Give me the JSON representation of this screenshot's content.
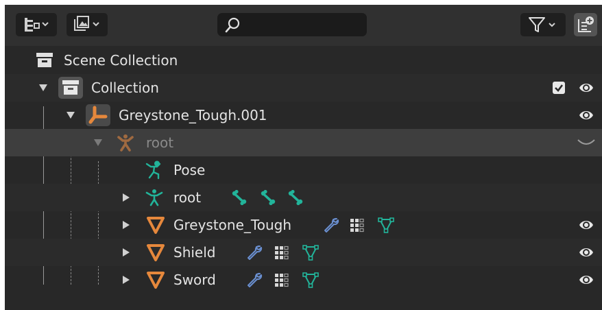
{
  "header": {
    "display_mode_icon": "outliner-view-icon",
    "filter_menu_icon": "image-stack-icon",
    "search": {
      "value": "",
      "placeholder": ""
    },
    "filter_icon": "funnel-icon",
    "new_collection_icon": "new-collection-icon"
  },
  "tree": {
    "scene_collection": {
      "label": "Scene Collection",
      "icon": "scene-collection-icon"
    },
    "collection": {
      "label": "Collection",
      "icon": "collection-icon",
      "checked": true,
      "visible": true
    },
    "armature_object": {
      "label": "Greystone_Tough.001",
      "icon": "armature-object-icon",
      "visible": true
    },
    "root_armature": {
      "label": "root",
      "icon": "armature-data-icon"
    },
    "pose": {
      "label": "Pose",
      "icon": "pose-icon"
    },
    "root_bone": {
      "label": "root",
      "icon": "bone-root-icon",
      "bones": [
        "bone-icon",
        "bone-icon",
        "bone-icon"
      ]
    },
    "meshes": [
      {
        "label": "Greystone_Tough",
        "icon": "mesh-object-icon",
        "modifiers": [
          "wrench-icon",
          "vertex-groups-icon",
          "mesh-data-icon"
        ],
        "visible": true
      },
      {
        "label": "Shield",
        "icon": "mesh-object-icon",
        "modifiers": [
          "wrench-icon",
          "vertex-groups-icon",
          "mesh-data-icon"
        ],
        "visible": true
      },
      {
        "label": "Sword",
        "icon": "mesh-object-icon",
        "modifiers": [
          "wrench-icon",
          "vertex-groups-icon",
          "mesh-data-icon"
        ],
        "visible": true
      }
    ]
  },
  "colors": {
    "background": "#282828",
    "row_alt": "#2b2b2b",
    "selected_dim": "#3e3e3e",
    "header": "#303030",
    "orange": "#e6883c",
    "green": "#22b49a",
    "blue": "#6a8fd0",
    "text": "#e4e4e4"
  }
}
